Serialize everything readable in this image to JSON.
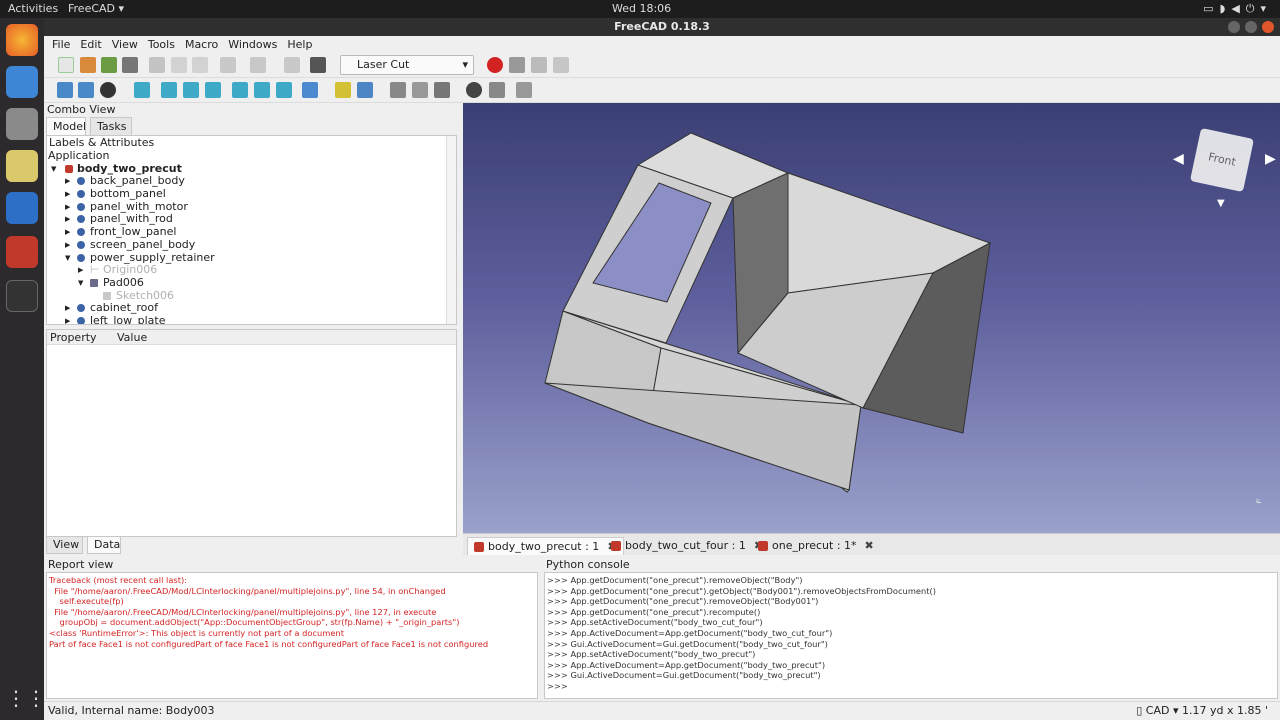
{
  "system": {
    "activities": "Activities",
    "app_menu": "FreeCAD ▾",
    "clock": "Wed 18:06"
  },
  "window": {
    "title": "FreeCAD 0.18.3"
  },
  "menu": [
    "File",
    "Edit",
    "View",
    "Tools",
    "Macro",
    "Windows",
    "Help"
  ],
  "toolbar": {
    "workbench": "Laser Cut Interlocking"
  },
  "combo": {
    "title": "Combo View",
    "tabs": [
      "Model",
      "Tasks"
    ],
    "labels_header": "Labels & Attributes",
    "root": "Application",
    "doc": "body_two_precut",
    "items": [
      {
        "label": "back_panel_body"
      },
      {
        "label": "bottom_panel"
      },
      {
        "label": "panel_with_motor"
      },
      {
        "label": "panel_with_rod"
      },
      {
        "label": "front_low_panel"
      },
      {
        "label": "screen_panel_body"
      },
      {
        "label": "power_supply_retainer"
      },
      {
        "label": "Origin006"
      },
      {
        "label": "Pad006"
      },
      {
        "label": "Sketch006"
      },
      {
        "label": "cabinet_roof"
      },
      {
        "label": "left_low_plate"
      }
    ],
    "prop_header": {
      "property": "Property",
      "value": "Value"
    },
    "bottom_tabs": [
      "View",
      "Data"
    ]
  },
  "viewport": {
    "navcube_face": "Front"
  },
  "doc_tabs": [
    "body_two_precut : 1",
    "body_two_cut_four : 1",
    "one_precut : 1*"
  ],
  "report": {
    "title": "Report view",
    "lines": [
      "Traceback (most recent call last):",
      "  File \"/home/aaron/.FreeCAD/Mod/LCInterlocking/panel/multiplejoins.py\", line 54, in onChanged",
      "    self.execute(fp)",
      "  File \"/home/aaron/.FreeCAD/Mod/LCInterlocking/panel/multiplejoins.py\", line 127, in execute",
      "    groupObj = document.addObject(\"App::DocumentObjectGroup\", str(fp.Name) + \"_origin_parts\")",
      "<class 'RuntimeError'>: This object is currently not part of a document",
      "Part of face Face1 is not configuredPart of face Face1 is not configuredPart of face Face1 is not configured"
    ]
  },
  "console": {
    "title": "Python console",
    "lines": [
      ">>> App.getDocument(\"one_precut\").removeObject(\"Body\")",
      ">>> App.getDocument(\"one_precut\").getObject(\"Body001\").removeObjectsFromDocument()",
      ">>> App.getDocument(\"one_precut\").removeObject(\"Body001\")",
      ">>> App.getDocument(\"one_precut\").recompute()",
      ">>> App.setActiveDocument(\"body_two_cut_four\")",
      ">>> App.ActiveDocument=App.getDocument(\"body_two_cut_four\")",
      ">>> Gui.ActiveDocument=Gui.getDocument(\"body_two_cut_four\")",
      ">>> App.setActiveDocument(\"body_two_precut\")",
      ">>> App.ActiveDocument=App.getDocument(\"body_two_precut\")",
      ">>> Gui.ActiveDocument=Gui.getDocument(\"body_two_precut\")",
      ">>>"
    ]
  },
  "status": {
    "left": "Valid, Internal name: Body003",
    "right": "▯ CAD ▾   1.17 yd x 1.85 '"
  }
}
